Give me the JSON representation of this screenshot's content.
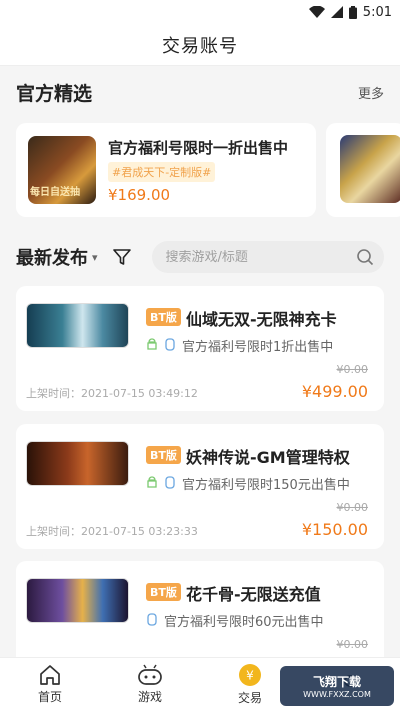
{
  "status_bar": {
    "time": "5:01"
  },
  "header": {
    "title": "交易账号"
  },
  "featured": {
    "section_title": "官方精选",
    "more_label": "更多",
    "item": {
      "title": "官方福利号限时一折出售中",
      "tag": "#君成天下-定制版#",
      "price": "¥169.00",
      "thumb_caption": "每日自送抽"
    }
  },
  "latest": {
    "section_title": "最新发布",
    "search_placeholder": "搜索游戏/标题"
  },
  "listings": [
    {
      "badge": "BT版",
      "title": "仙域无双-无限神充卡",
      "desc": "官方福利号限时1折出售中",
      "orig_price": "¥0.00",
      "time": "上架时间：2021-07-15 03:49:12",
      "price": "¥499.00"
    },
    {
      "badge": "BT版",
      "title": "妖神传说-GM管理特权",
      "desc": "官方福利号限时150元出售中",
      "orig_price": "¥0.00",
      "time": "上架时间：2021-07-15 03:23:33",
      "price": "¥150.00"
    },
    {
      "badge": "BT版",
      "title": "花千骨-无限送充值",
      "desc": "官方福利号限时60元出售中",
      "orig_price": "¥0.00",
      "time": "",
      "price": ""
    }
  ],
  "tabs": [
    {
      "label": "首页"
    },
    {
      "label": "游戏"
    },
    {
      "label": "交易"
    },
    {
      "label": ""
    }
  ],
  "watermark": {
    "line1": "飞翔下载",
    "line2": "WWW.FXXZ.COM"
  },
  "colors": {
    "accent": "#f07a1a",
    "badge": "#f5a64a",
    "tag_bg": "#fff2d8",
    "trade_icon": "#f2b61d"
  }
}
